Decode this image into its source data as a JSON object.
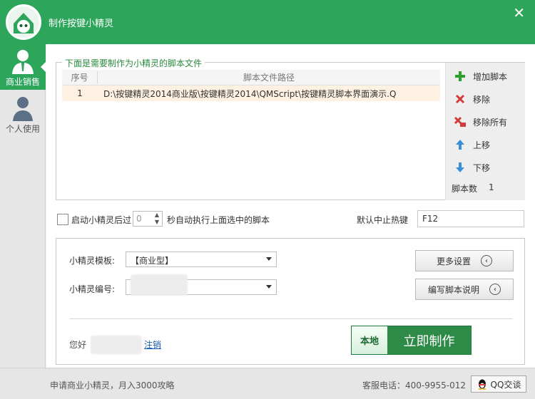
{
  "window": {
    "title": "制作按键小精灵",
    "close_glyph": "✕"
  },
  "sidebar": {
    "items": [
      {
        "label": "商业销售",
        "icon": "business-user-icon",
        "active": true
      },
      {
        "label": "个人使用",
        "icon": "personal-user-icon",
        "active": false
      }
    ]
  },
  "scripts_panel": {
    "legend": "下面是需要制作为小精灵的脚本文件",
    "columns": [
      "序号",
      "脚本文件路径"
    ],
    "rows": [
      {
        "index": "1",
        "path": "D:\\按键精灵2014商业版\\按键精灵2014\\QMScript\\按键精灵脚本界面演示.Q"
      }
    ],
    "actions": [
      {
        "label": "增加脚本",
        "icon": "plus-icon",
        "color": "#2ca02c"
      },
      {
        "label": "移除",
        "icon": "remove-icon",
        "color": "#d33b3b"
      },
      {
        "label": "移除所有",
        "icon": "remove-all-icon",
        "color": "#d33b3b"
      },
      {
        "label": "上移",
        "icon": "arrow-up-icon",
        "color": "#3a8fd8"
      },
      {
        "label": "下移",
        "icon": "arrow-down-icon",
        "color": "#3a8fd8"
      }
    ],
    "count_label": "脚本数",
    "count_value": "1"
  },
  "autorun": {
    "label_before": "启动小精灵后过",
    "seconds": "0",
    "label_after": "秒自动执行上面选中的脚本",
    "checked": false
  },
  "hotkey": {
    "label": "默认中止热键",
    "value": "F12"
  },
  "settings": {
    "template_label": "小精灵模板:",
    "template_value": "【商业型】",
    "id_label": "小精灵编号:",
    "more_button": "更多设置",
    "write_button": "编写脚本说明",
    "hello": "您好",
    "logout": "注销",
    "local_label": "本地",
    "make_label": "立即制作"
  },
  "footer": {
    "left_text": "申请商业小精灵，月入3000攻略",
    "phone": "客服电话：400-9955-012",
    "qq_label": "QQ交谈"
  },
  "colors": {
    "brand_green": "#2da65b",
    "button_green": "#2e8b47"
  }
}
